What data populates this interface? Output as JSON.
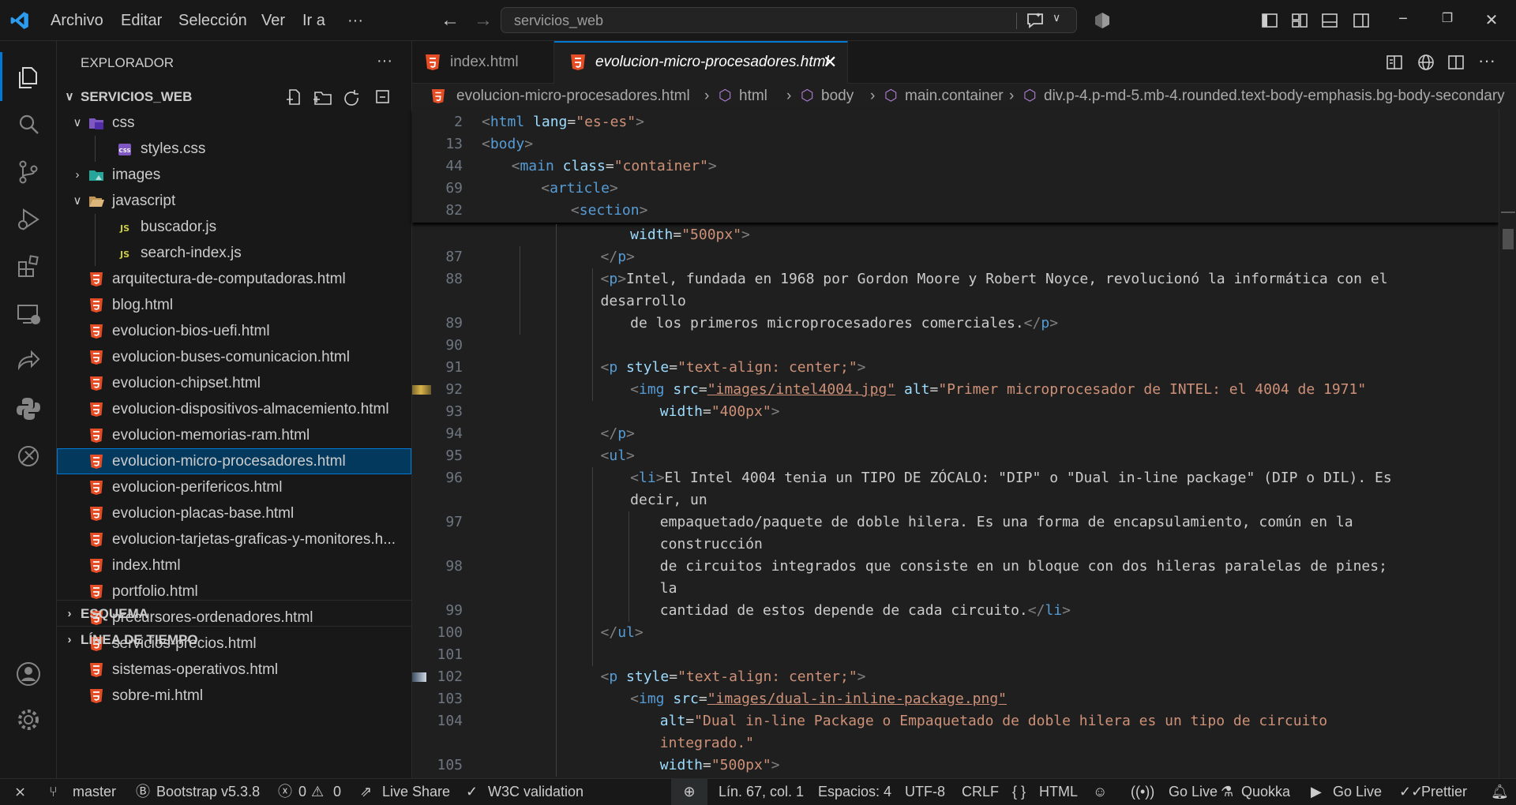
{
  "titlebar": {
    "menu": [
      "Archivo",
      "Editar",
      "Selección",
      "Ver",
      "Ir a",
      "···"
    ],
    "search_text": "servicios_web"
  },
  "explorer": {
    "title": "EXPLORADOR",
    "root": "SERVICIOS_WEB",
    "items": [
      {
        "label": "css",
        "type": "folder-css",
        "depth": 1,
        "expanded": true
      },
      {
        "label": "styles.css",
        "type": "css",
        "depth": 2
      },
      {
        "label": "images",
        "type": "folder-images",
        "depth": 1,
        "expanded": false
      },
      {
        "label": "javascript",
        "type": "folder",
        "depth": 1,
        "expanded": true
      },
      {
        "label": "buscador.js",
        "type": "js",
        "depth": 2
      },
      {
        "label": "search-index.js",
        "type": "js",
        "depth": 2
      },
      {
        "label": "arquitectura-de-computadoras.html",
        "type": "html",
        "depth": 1
      },
      {
        "label": "blog.html",
        "type": "html",
        "depth": 1
      },
      {
        "label": "evolucion-bios-uefi.html",
        "type": "html",
        "depth": 1
      },
      {
        "label": "evolucion-buses-comunicacion.html",
        "type": "html",
        "depth": 1
      },
      {
        "label": "evolucion-chipset.html",
        "type": "html",
        "depth": 1
      },
      {
        "label": "evolucion-dispositivos-almacemiento.html",
        "type": "html",
        "depth": 1
      },
      {
        "label": "evolucion-memorias-ram.html",
        "type": "html",
        "depth": 1
      },
      {
        "label": "evolucion-micro-procesadores.html",
        "type": "html",
        "depth": 1,
        "selected": true
      },
      {
        "label": "evolucion-perifericos.html",
        "type": "html",
        "depth": 1
      },
      {
        "label": "evolucion-placas-base.html",
        "type": "html",
        "depth": 1
      },
      {
        "label": "evolucion-tarjetas-graficas-y-monitores.h...",
        "type": "html",
        "depth": 1
      },
      {
        "label": "index.html",
        "type": "html",
        "depth": 1
      },
      {
        "label": "portfolio.html",
        "type": "html",
        "depth": 1
      },
      {
        "label": "precursores-ordenadores.html",
        "type": "html",
        "depth": 1
      },
      {
        "label": "servicios-precios.html",
        "type": "html",
        "depth": 1
      },
      {
        "label": "sistemas-operativos.html",
        "type": "html",
        "depth": 1
      },
      {
        "label": "sobre-mi.html",
        "type": "html",
        "depth": 1
      }
    ],
    "outline": "ESQUEMA",
    "timeline": "LÍNEA DE TIEMPO"
  },
  "tabs": [
    {
      "label": "index.html",
      "active": false
    },
    {
      "label": "evolucion-micro-procesadores.html",
      "active": true
    }
  ],
  "breadcrumbs": [
    "evolucion-micro-procesadores.html",
    "html",
    "body",
    "main.container",
    "div.p-4.p-md-5.mb-4.rounded.text-body-emphasis.bg-body-secondary"
  ],
  "sticky_lines": [
    {
      "n": "2",
      "tokens": [
        [
          "p",
          "<"
        ],
        [
          "t",
          "html"
        ],
        [
          "a",
          " lang"
        ],
        [
          "c",
          "="
        ],
        [
          "s",
          "\"es-es\""
        ],
        [
          "p",
          ">"
        ]
      ],
      "indent": 0
    },
    {
      "n": "13",
      "tokens": [
        [
          "p",
          "<"
        ],
        [
          "t",
          "body"
        ],
        [
          "p",
          ">"
        ]
      ],
      "indent": 0
    },
    {
      "n": "44",
      "tokens": [
        [
          "p",
          "<"
        ],
        [
          "t",
          "main"
        ],
        [
          "a",
          " class"
        ],
        [
          "c",
          "="
        ],
        [
          "s",
          "\"container\""
        ],
        [
          "p",
          ">"
        ]
      ],
      "indent": 4
    },
    {
      "n": "69",
      "tokens": [
        [
          "p",
          "<"
        ],
        [
          "t",
          "article"
        ],
        [
          "p",
          ">"
        ]
      ],
      "indent": 8
    },
    {
      "n": "82",
      "tokens": [
        [
          "p",
          "<"
        ],
        [
          "t",
          "section"
        ],
        [
          "p",
          ">"
        ]
      ],
      "indent": 12
    }
  ],
  "code_lines": [
    {
      "n": "",
      "indent": 20,
      "tokens": [
        [
          "a",
          "width"
        ],
        [
          "c",
          "="
        ],
        [
          "s",
          "\"500px\""
        ],
        [
          "p",
          ">"
        ]
      ]
    },
    {
      "n": "87",
      "indent": 16,
      "tokens": [
        [
          "p",
          "</"
        ],
        [
          "t",
          "p"
        ],
        [
          "p",
          ">"
        ]
      ]
    },
    {
      "n": "88",
      "indent": 16,
      "tokens": [
        [
          "p",
          "<"
        ],
        [
          "t",
          "p"
        ],
        [
          "p",
          ">"
        ],
        [
          "c",
          "Intel, fundada en 1968 por Gordon Moore y Robert Noyce, revolucionó la informática con el"
        ]
      ]
    },
    {
      "n": "",
      "indent": 16,
      "tokens": [
        [
          "c",
          "desarrollo"
        ]
      ]
    },
    {
      "n": "89",
      "indent": 20,
      "tokens": [
        [
          "c",
          "de los primeros microprocesadores comerciales."
        ],
        [
          "p",
          "</"
        ],
        [
          "t",
          "p"
        ],
        [
          "p",
          ">"
        ]
      ]
    },
    {
      "n": "90",
      "indent": 0,
      "tokens": []
    },
    {
      "n": "91",
      "indent": 16,
      "tokens": [
        [
          "p",
          "<"
        ],
        [
          "t",
          "p"
        ],
        [
          "a",
          " style"
        ],
        [
          "c",
          "="
        ],
        [
          "s",
          "\"text-align: center;\""
        ],
        [
          "p",
          ">"
        ]
      ]
    },
    {
      "n": "92",
      "indent": 20,
      "tokens": [
        [
          "p",
          "<"
        ],
        [
          "t",
          "img"
        ],
        [
          "a",
          " src"
        ],
        [
          "c",
          "="
        ],
        [
          "su",
          "\"images/intel4004.jpg\""
        ],
        [
          "a",
          " alt"
        ],
        [
          "c",
          "="
        ],
        [
          "s",
          "\"Primer microprocesador de INTEL: el 4004 de 1971\""
        ]
      ]
    },
    {
      "n": "93",
      "indent": 24,
      "tokens": [
        [
          "a",
          "width"
        ],
        [
          "c",
          "="
        ],
        [
          "s",
          "\"400px\""
        ],
        [
          "p",
          ">"
        ]
      ]
    },
    {
      "n": "94",
      "indent": 16,
      "tokens": [
        [
          "p",
          "</"
        ],
        [
          "t",
          "p"
        ],
        [
          "p",
          ">"
        ]
      ]
    },
    {
      "n": "95",
      "indent": 16,
      "tokens": [
        [
          "p",
          "<"
        ],
        [
          "t",
          "ul"
        ],
        [
          "p",
          ">"
        ]
      ]
    },
    {
      "n": "96",
      "indent": 20,
      "tokens": [
        [
          "p",
          "<"
        ],
        [
          "t",
          "li"
        ],
        [
          "p",
          ">"
        ],
        [
          "c",
          "El Intel 4004 tenia un TIPO DE ZÓCALO: \"DIP\" o \"Dual in-line package\" (DIP o DIL). Es"
        ]
      ]
    },
    {
      "n": "",
      "indent": 20,
      "tokens": [
        [
          "c",
          "decir, un"
        ]
      ]
    },
    {
      "n": "97",
      "indent": 24,
      "tokens": [
        [
          "c",
          "empaquetado/paquete de doble hilera. Es una forma de encapsulamiento, común en la"
        ]
      ]
    },
    {
      "n": "",
      "indent": 24,
      "tokens": [
        [
          "c",
          "construcción"
        ]
      ]
    },
    {
      "n": "98",
      "indent": 24,
      "tokens": [
        [
          "c",
          "de circuitos integrados que consiste en un bloque con dos hileras paralelas de pines;"
        ]
      ]
    },
    {
      "n": "",
      "indent": 24,
      "tokens": [
        [
          "c",
          "la"
        ]
      ]
    },
    {
      "n": "99",
      "indent": 24,
      "tokens": [
        [
          "c",
          "cantidad de estos depende de cada circuito."
        ],
        [
          "p",
          "</"
        ],
        [
          "t",
          "li"
        ],
        [
          "p",
          ">"
        ]
      ]
    },
    {
      "n": "100",
      "indent": 16,
      "tokens": [
        [
          "p",
          "</"
        ],
        [
          "t",
          "ul"
        ],
        [
          "p",
          ">"
        ]
      ]
    },
    {
      "n": "101",
      "indent": 0,
      "tokens": []
    },
    {
      "n": "102",
      "indent": 16,
      "tokens": [
        [
          "p",
          "<"
        ],
        [
          "t",
          "p"
        ],
        [
          "a",
          " style"
        ],
        [
          "c",
          "="
        ],
        [
          "s",
          "\"text-align: center;\""
        ],
        [
          "p",
          ">"
        ]
      ]
    },
    {
      "n": "103",
      "indent": 20,
      "tokens": [
        [
          "p",
          "<"
        ],
        [
          "t",
          "img"
        ],
        [
          "a",
          " src"
        ],
        [
          "c",
          "="
        ],
        [
          "su",
          "\"images/dual-in-inline-package.png\""
        ]
      ]
    },
    {
      "n": "104",
      "indent": 24,
      "tokens": [
        [
          "a",
          "alt"
        ],
        [
          "c",
          "="
        ],
        [
          "s",
          "\"Dual in-line Package o Empaquetado de doble hilera es un tipo de circuito"
        ]
      ]
    },
    {
      "n": "",
      "indent": 24,
      "tokens": [
        [
          "s",
          "integrado.\""
        ]
      ]
    },
    {
      "n": "105",
      "indent": 24,
      "tokens": [
        [
          "a",
          "width"
        ],
        [
          "c",
          "="
        ],
        [
          "s",
          "\"500px\""
        ],
        [
          "p",
          ">"
        ]
      ]
    }
  ],
  "status": {
    "branch": "master",
    "bootstrap": "Bootstrap v5.3.8",
    "errors": "0",
    "warnings": "0",
    "live_share": "Live Share",
    "w3c": "W3C validation",
    "position": "Lín. 67, col. 1",
    "spaces": "Espacios: 4",
    "encoding": "UTF-8",
    "eol": "CRLF",
    "language": "HTML",
    "go_live_1": "Go Live",
    "quokka": "Quokka",
    "go_live_2": "Go Live",
    "prettier": "Prettier"
  },
  "colors": {
    "accent": "#0078d4",
    "html_icon": "#e44d26",
    "css_icon": "#7e57c2",
    "js_icon": "#cbcb41"
  }
}
